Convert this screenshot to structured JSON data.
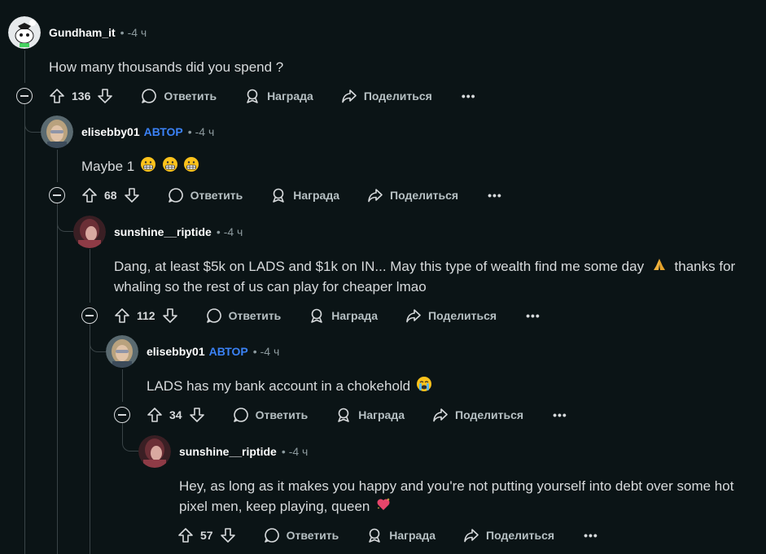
{
  "labels": {
    "reply": "Ответить",
    "award": "Награда",
    "share": "Поделиться",
    "more": "•••",
    "op": "АВТОР",
    "dot": "•"
  },
  "comments": [
    {
      "author": "Gundham_it",
      "op": false,
      "time": "-4 ч",
      "text": "How many thousands did you spend ?",
      "votes": "136",
      "emoji": []
    },
    {
      "author": "elisebby01",
      "op": true,
      "time": "-4 ч",
      "text": "Maybe 1",
      "votes": "68",
      "emoji": [
        "grimacing-face-icon",
        "grimacing-face-icon",
        "grimacing-face-icon"
      ]
    },
    {
      "author": "sunshine__riptide",
      "op": false,
      "time": "-4 ч",
      "text": "Dang, at least $5k on LADS and $1k on IN... May this type of wealth find me some day",
      "text2": "thanks for whaling so the rest of us can play for cheaper lmao",
      "votes": "112",
      "emoji": [
        "folded-hands-icon"
      ]
    },
    {
      "author": "elisebby01",
      "op": true,
      "time": "-4 ч",
      "text": "LADS has my bank account in a chokehold",
      "votes": "34",
      "emoji": [
        "crying-face-icon"
      ]
    },
    {
      "author": "sunshine__riptide",
      "op": false,
      "time": "-4 ч",
      "text": "Hey, as long as it makes you happy and you're not putting yourself into debt over some hot pixel men, keep playing, queen",
      "votes": "57",
      "emoji": [
        "sparkling-heart-icon"
      ]
    }
  ],
  "colors": {
    "background": "#0b1416",
    "op_badge": "#3b82f6",
    "text": "#d7dadc",
    "meta": "#8c9a9e"
  }
}
